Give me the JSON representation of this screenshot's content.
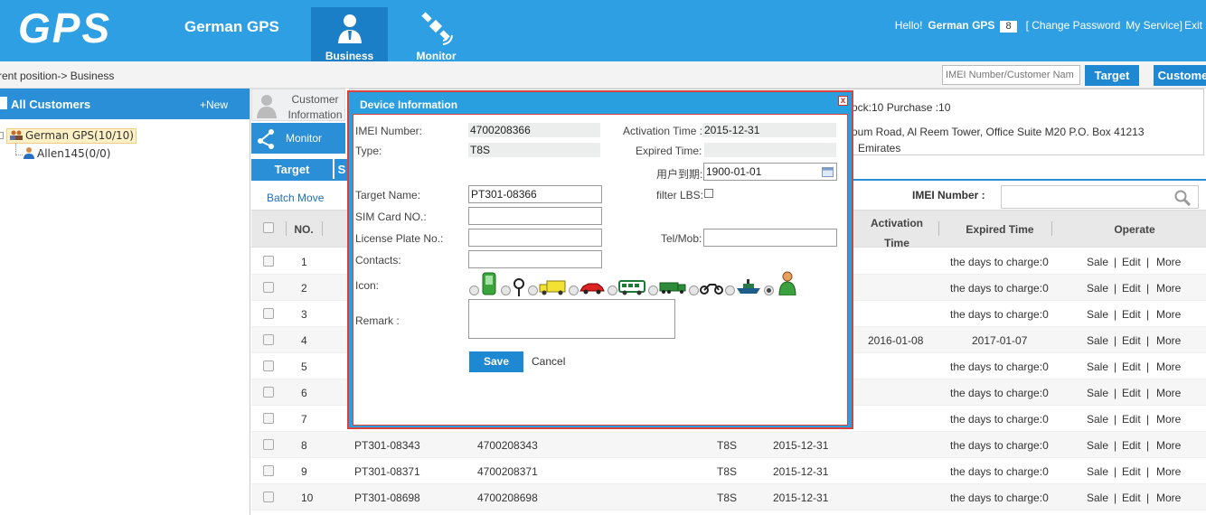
{
  "header": {
    "logo": "GPS",
    "brand": "German GPS",
    "tabs": [
      {
        "label": "Business",
        "icon": "business-user-icon",
        "active": true
      },
      {
        "label": "Monitor",
        "icon": "satellite-icon",
        "active": false
      }
    ],
    "greeting": "Hello!",
    "user": "German GPS",
    "message_count": "8",
    "change_password": "[ Change Password",
    "my_service": "My Service]",
    "exit": "Exit",
    "accent": "#2f9fe3"
  },
  "crumbbar": {
    "breadcrumb": "rrent position-> Business",
    "search_placeholder": "IMEI Number/Customer Nam",
    "target_button": "Target",
    "customer_button": "Customer"
  },
  "sidebar": {
    "title": "All Customers",
    "new_label": "+New",
    "tree": {
      "root": "German GPS(10/10)",
      "children": [
        "Allen145(0/0)"
      ]
    }
  },
  "main": {
    "customer_info_tab": "Customer Information",
    "monitor_tab": "Monitor",
    "info_lines": [
      "ock:10 Purchase :10",
      "oum Road, Al Reem Tower, Office Suite M20 P.O. Box 41213",
      "Emirates"
    ],
    "subtabs": [
      "Target",
      "S"
    ],
    "batch_move": "Batch Move",
    "imei_label": "IMEI Number :",
    "columns": {
      "no": "NO.",
      "activation": "Activation Time",
      "expired": "Expired Time",
      "operate": "Operate"
    },
    "rows": [
      {
        "no": "1",
        "target": "",
        "imei": "",
        "type": "",
        "activation": "",
        "expired": "the days to charge:0"
      },
      {
        "no": "2",
        "target": "",
        "imei": "",
        "type": "",
        "activation": "",
        "expired": "the days to charge:0"
      },
      {
        "no": "3",
        "target": "",
        "imei": "",
        "type": "",
        "activation": "",
        "expired": "the days to charge:0"
      },
      {
        "no": "4",
        "target": "",
        "imei": "",
        "type": "",
        "activation": "2016-01-08",
        "expired": "2017-01-07"
      },
      {
        "no": "5",
        "target": "",
        "imei": "",
        "type": "",
        "activation": "",
        "expired": "the days to charge:0"
      },
      {
        "no": "6",
        "target": "",
        "imei": "",
        "type": "",
        "activation": "",
        "expired": "the days to charge:0"
      },
      {
        "no": "7",
        "target": "",
        "imei": "",
        "type": "",
        "activation": "",
        "expired": "the days to charge:0"
      },
      {
        "no": "8",
        "target": "PT301-08343",
        "imei": "4700208343",
        "type": "T8S",
        "activation": "2015-12-31",
        "expired": "the days to charge:0"
      },
      {
        "no": "9",
        "target": "PT301-08371",
        "imei": "4700208371",
        "type": "T8S",
        "activation": "2015-12-31",
        "expired": "the days to charge:0"
      },
      {
        "no": "10",
        "target": "PT301-08698",
        "imei": "4700208698",
        "type": "T8S",
        "activation": "2015-12-31",
        "expired": "the days to charge:0"
      }
    ],
    "ops": {
      "sale": "Sale",
      "edit": "Edit",
      "more": "More",
      "sep": "|"
    }
  },
  "modal": {
    "title": "Device Information",
    "close": "x",
    "imei_label": "IMEI Number:",
    "imei_value": "4700208366",
    "activation_label": "Activation Time :",
    "activation_value": "2015-12-31",
    "type_label": "Type:",
    "type_value": "T8S",
    "expired_label": "Expired Time:",
    "expired_value": "",
    "user_expiry_label": "用户到期:",
    "user_expiry_value": "1900-01-01",
    "target_name_label": "Target Name:",
    "target_name_value": "PT301-08366",
    "filter_lbs_label": "filter LBS:",
    "sim_label": "SIM Card NO.:",
    "sim_value": "",
    "plate_label": "License Plate No.:",
    "plate_value": "",
    "tel_label": "Tel/Mob:",
    "tel_value": "",
    "contacts_label": "Contacts:",
    "contacts_value": "",
    "icon_label": "Icon:",
    "icon_options": [
      "phone-icon",
      "pin-icon",
      "truck-icon",
      "car-icon",
      "bus-icon",
      "lorry-icon",
      "motorbike-icon",
      "ship-icon",
      "person-icon"
    ],
    "selected_icon": "person-icon",
    "remark_label": "Remark :",
    "remark_value": "",
    "save": "Save",
    "cancel": "Cancel"
  }
}
